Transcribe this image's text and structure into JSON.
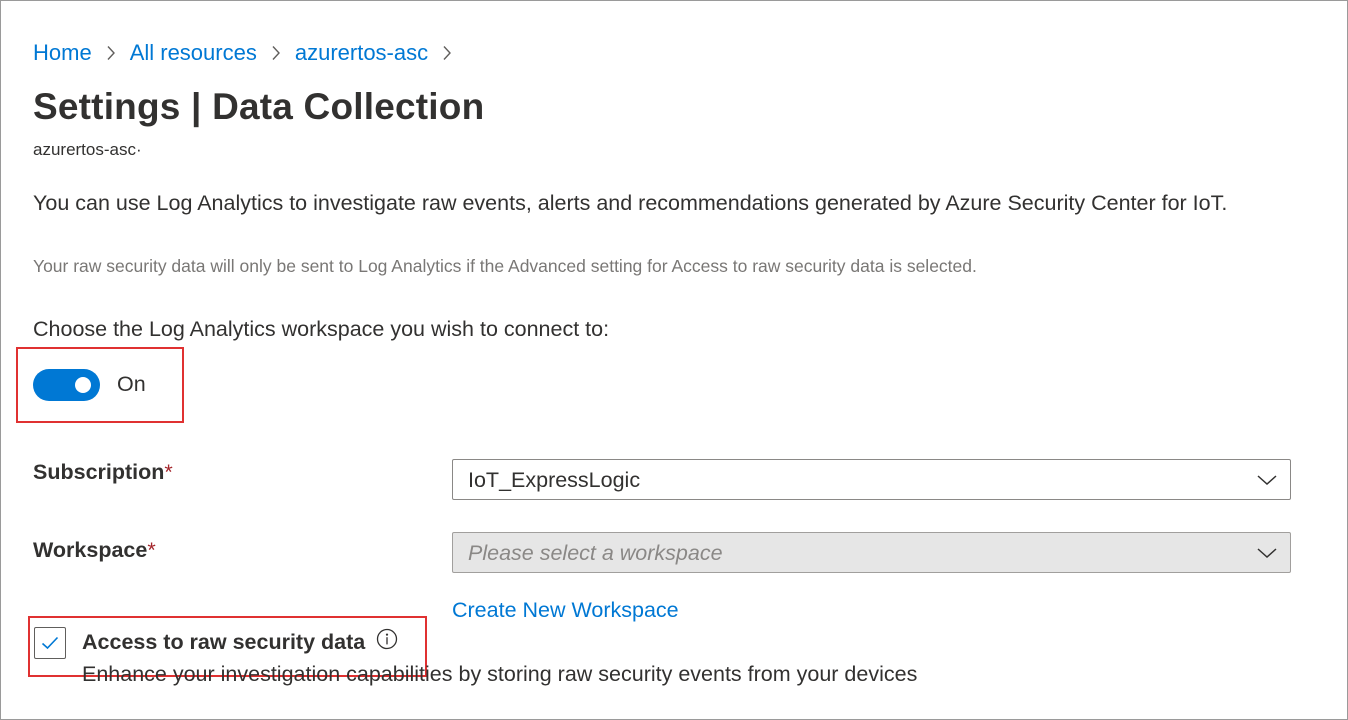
{
  "breadcrumb": {
    "items": [
      "Home",
      "All resources",
      "azurertos-asc"
    ]
  },
  "header": {
    "title": "Settings | Data Collection",
    "resource_name": "azurertos-asc·"
  },
  "main": {
    "description": "You can use Log Analytics to investigate raw events, alerts and recommendations generated by Azure Security Center for IoT.",
    "note": "Your raw security data will only be sent to Log Analytics if the Advanced setting for Access to raw security data is selected.",
    "choose_label": "Choose the Log Analytics workspace you wish to connect to:",
    "toggle": {
      "state_label": "On",
      "checked": true
    },
    "subscription": {
      "label": "Subscription",
      "required_marker": "*",
      "value": "IoT_ExpressLogic"
    },
    "workspace": {
      "label": "Workspace",
      "required_marker": "*",
      "placeholder": "Please select a workspace"
    },
    "create_workspace_link": "Create New Workspace",
    "raw_data": {
      "label": "Access to raw security data",
      "description": "Enhance your investigation capabilities by storing raw security events from your devices",
      "checked": true
    }
  },
  "colors": {
    "accent": "#0078d4",
    "highlight": "#e03131",
    "required": "#a4262c"
  }
}
